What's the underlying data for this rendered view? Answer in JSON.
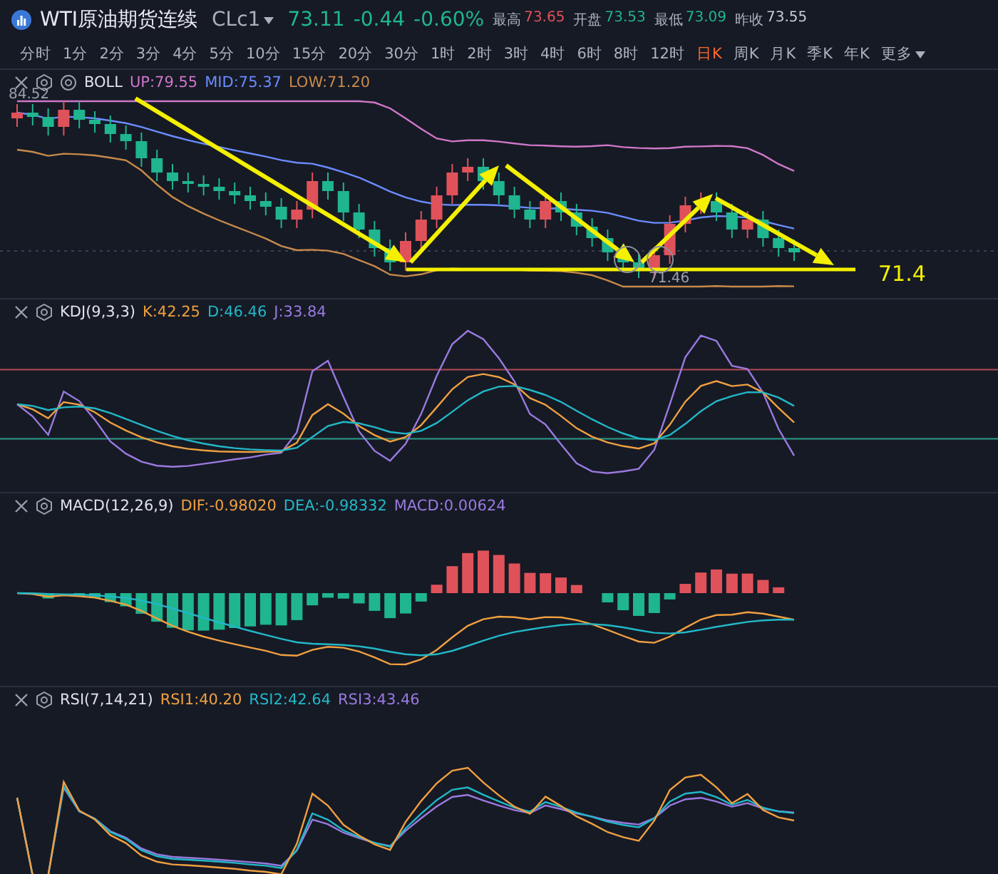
{
  "header": {
    "title": "WTI原油期货连续",
    "symbol": "CLc1",
    "price": "73.11",
    "change": "-0.44",
    "change_pct": "-0.60%",
    "stats": [
      {
        "label": "最高",
        "value": "73.65",
        "color": "#e0525a"
      },
      {
        "label": "开盘",
        "value": "73.53",
        "color": "#1fb58f"
      },
      {
        "label": "最低",
        "value": "73.09",
        "color": "#1fb58f"
      },
      {
        "label": "昨收",
        "value": "73.55",
        "color": "#c8ccd4"
      }
    ]
  },
  "periods": [
    {
      "label": "分时",
      "selected": false,
      "kind": "tab"
    },
    {
      "label": "1分",
      "selected": false,
      "kind": "tab"
    },
    {
      "label": "2分",
      "selected": false,
      "kind": "tab"
    },
    {
      "label": "3分",
      "selected": false,
      "kind": "tab"
    },
    {
      "label": "4分",
      "selected": false,
      "kind": "tab"
    },
    {
      "label": "5分",
      "selected": false,
      "kind": "tab"
    },
    {
      "label": "10分",
      "selected": false,
      "kind": "tab"
    },
    {
      "label": "15分",
      "selected": false,
      "kind": "tab"
    },
    {
      "label": "20分",
      "selected": false,
      "kind": "tab"
    },
    {
      "label": "30分",
      "selected": false,
      "kind": "tab"
    },
    {
      "label": "1时",
      "selected": false,
      "kind": "tab"
    },
    {
      "label": "2时",
      "selected": false,
      "kind": "tab"
    },
    {
      "label": "3时",
      "selected": false,
      "kind": "tab"
    },
    {
      "label": "4时",
      "selected": false,
      "kind": "tab"
    },
    {
      "label": "6时",
      "selected": false,
      "kind": "tab"
    },
    {
      "label": "8时",
      "selected": false,
      "kind": "tab"
    },
    {
      "label": "12时",
      "selected": false,
      "kind": "tab"
    },
    {
      "label": "日K",
      "selected": true,
      "kind": "tab"
    },
    {
      "label": "周K",
      "selected": false,
      "kind": "tab"
    },
    {
      "label": "月K",
      "selected": false,
      "kind": "tab"
    },
    {
      "label": "季K",
      "selected": false,
      "kind": "tab"
    },
    {
      "label": "年K",
      "selected": false,
      "kind": "tab"
    },
    {
      "label": "更多",
      "selected": false,
      "kind": "menu"
    }
  ],
  "price_chart": {
    "name": "BOLL",
    "values": [
      {
        "text": "UP:79.55",
        "color": "#d077c9"
      },
      {
        "text": "MID:75.37",
        "color": "#6b8cff"
      },
      {
        "text": "LOW:71.20",
        "color": "#c88a4a"
      }
    ],
    "high_label": "84.52",
    "low_label": "71.46",
    "target_label": "71.4"
  },
  "indicators": [
    {
      "kind": "kdj",
      "name": "KDJ(9,3,3)",
      "values": [
        {
          "text": "K:42.25",
          "color": "#f0a040"
        },
        {
          "text": "D:46.46",
          "color": "#22b8c8"
        },
        {
          "text": "J:33.84",
          "color": "#9a7ae0"
        }
      ]
    },
    {
      "kind": "macd",
      "name": "MACD(12,26,9)",
      "values": [
        {
          "text": "DIF:-0.98020",
          "color": "#f0a040"
        },
        {
          "text": "DEA:-0.98332",
          "color": "#22b8c8"
        },
        {
          "text": "MACD:0.00624",
          "color": "#9a7ae0"
        }
      ]
    },
    {
      "kind": "rsi",
      "name": "RSI(7,14,21)",
      "values": [
        {
          "text": "RSI1:40.20",
          "color": "#f0a040"
        },
        {
          "text": "RSI2:42.64",
          "color": "#22b8c8"
        },
        {
          "text": "RSI3:43.46",
          "color": "#9a7ae0"
        }
      ]
    }
  ]
}
